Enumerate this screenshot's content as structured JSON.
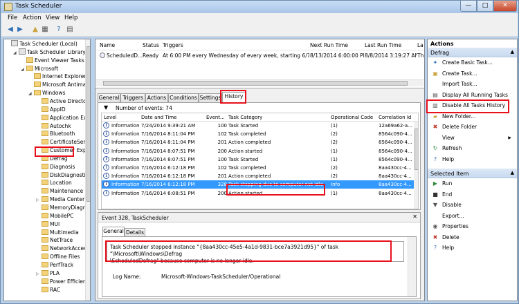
{
  "window": {
    "title": "Task Scheduler",
    "min": "—",
    "max": "□",
    "close": "✕"
  },
  "menu": [
    "File",
    "Action",
    "View",
    "Help"
  ],
  "toolbar": [
    {
      "icon": "back-arrow-icon",
      "glyph": "◀",
      "color": "#2e6fb5"
    },
    {
      "icon": "forward-arrow-icon",
      "glyph": "▶",
      "color": "#2e6fb5"
    },
    {
      "icon": "up-folder-icon",
      "glyph": "▲",
      "color": "#c9a23c"
    },
    {
      "icon": "show-hide-tree-icon",
      "glyph": "▦",
      "color": "#555555"
    },
    {
      "icon": "help-icon",
      "glyph": "?",
      "color": "#2e6fb5"
    },
    {
      "icon": "properties-icon",
      "glyph": "▤",
      "color": "#555555"
    }
  ],
  "tree": [
    {
      "label": "Task Scheduler (Local)",
      "depth": 0,
      "exp": "",
      "icon": "lib"
    },
    {
      "label": "Task Scheduler Library",
      "depth": 1,
      "exp": "◢",
      "icon": "lib"
    },
    {
      "label": "Event Viewer Tasks",
      "depth": 2,
      "exp": "",
      "icon": "folder"
    },
    {
      "label": "Microsoft",
      "depth": 2,
      "exp": "◢",
      "icon": "folder"
    },
    {
      "label": "Internet Explorer",
      "depth": 3,
      "exp": "",
      "icon": "folder"
    },
    {
      "label": "Microsoft Antimal",
      "depth": 3,
      "exp": "",
      "icon": "folder"
    },
    {
      "label": "Windows",
      "depth": 3,
      "exp": "◢",
      "icon": "folder"
    },
    {
      "label": "Active Director",
      "depth": 4,
      "exp": "",
      "icon": "folder"
    },
    {
      "label": "AppID",
      "depth": 4,
      "exp": "",
      "icon": "folder"
    },
    {
      "label": "Application Exp",
      "depth": 4,
      "exp": "",
      "icon": "folder"
    },
    {
      "label": "Autochk",
      "depth": 4,
      "exp": "",
      "icon": "folder"
    },
    {
      "label": "Bluetooth",
      "depth": 4,
      "exp": "",
      "icon": "folder"
    },
    {
      "label": "CertificateServi",
      "depth": 4,
      "exp": "",
      "icon": "folder"
    },
    {
      "label": "Customer Expe",
      "depth": 4,
      "exp": "",
      "icon": "folder"
    },
    {
      "label": "Defrag",
      "depth": 4,
      "exp": "",
      "icon": "folder"
    },
    {
      "label": "Diagnosis",
      "depth": 4,
      "exp": "",
      "icon": "folder"
    },
    {
      "label": "DiskDiagnostic",
      "depth": 4,
      "exp": "",
      "icon": "folder"
    },
    {
      "label": "Location",
      "depth": 4,
      "exp": "",
      "icon": "folder"
    },
    {
      "label": "Maintenance",
      "depth": 4,
      "exp": "",
      "icon": "folder"
    },
    {
      "label": "Media Center",
      "depth": 4,
      "exp": "▷",
      "icon": "folder"
    },
    {
      "label": "MemoryDiagno",
      "depth": 4,
      "exp": "",
      "icon": "folder"
    },
    {
      "label": "MobilePC",
      "depth": 4,
      "exp": "",
      "icon": "folder"
    },
    {
      "label": "MUI",
      "depth": 4,
      "exp": "",
      "icon": "folder"
    },
    {
      "label": "Multimedia",
      "depth": 4,
      "exp": "",
      "icon": "folder"
    },
    {
      "label": "NetTrace",
      "depth": 4,
      "exp": "",
      "icon": "folder"
    },
    {
      "label": "NetworkAccess",
      "depth": 4,
      "exp": "",
      "icon": "folder"
    },
    {
      "label": "Offline Files",
      "depth": 4,
      "exp": "",
      "icon": "folder"
    },
    {
      "label": "PerfTrack",
      "depth": 4,
      "exp": "",
      "icon": "folder"
    },
    {
      "label": "PLA",
      "depth": 4,
      "exp": "▷",
      "icon": "folder"
    },
    {
      "label": "Power Efficienc",
      "depth": 4,
      "exp": "",
      "icon": "folder"
    },
    {
      "label": "RAC",
      "depth": 4,
      "exp": "",
      "icon": "folder"
    }
  ],
  "tasklist": {
    "headers": [
      "Name",
      "Status",
      "Triggers",
      "Next Run Time",
      "Last Run Time",
      "La"
    ],
    "row": [
      "ScheduledD...",
      "Ready",
      "At 6:00 PM every Wednesday of every week, starting 6/7/2012",
      "8/13/2014 6:00:00 PM",
      "8/8/2014 3:19:27 AM",
      "Th"
    ]
  },
  "tabs": [
    "General",
    "Triggers",
    "Actions",
    "Conditions",
    "Settings",
    "History"
  ],
  "history": {
    "count_text": "Number of events: 74",
    "headers": [
      "Level",
      "Date and Time",
      "Event...",
      "Task Category",
      "Operational Code",
      "Correlation Id"
    ],
    "rows": [
      [
        "Information",
        "7/24/2014 9:39:21 AM",
        "100",
        "Task Started",
        "(1)",
        "12a69a62-a..."
      ],
      [
        "Information",
        "7/16/2014 8:11:04 PM",
        "102",
        "Task completed",
        "(2)",
        "8564c090-4..."
      ],
      [
        "Information",
        "7/16/2014 8:11:04 PM",
        "201",
        "Action completed",
        "(2)",
        "8564c090-4..."
      ],
      [
        "Information",
        "7/16/2014 8:07:51 PM",
        "200",
        "Action started",
        "(1)",
        "8564c090-4..."
      ],
      [
        "Information",
        "7/16/2014 8:07:51 PM",
        "100",
        "Task Started",
        "(1)",
        "8564c090-4..."
      ],
      [
        "Information",
        "7/16/2014 6:12:18 PM",
        "102",
        "Task completed",
        "(2)",
        "8aa430cc-4..."
      ],
      [
        "Information",
        "7/16/2014 6:12:18 PM",
        "201",
        "Action completed",
        "(2)",
        "8aa430cc-4..."
      ],
      [
        "Information",
        "7/16/2014 6:12:18 PM",
        "328",
        "Task stopping due to computer not idle",
        "Info",
        "8aa430cc-4..."
      ],
      [
        "Information",
        "7/16/2014 6:08:51 PM",
        "200",
        "Action started",
        "(1)",
        "8aa430cc-4..."
      ]
    ],
    "selected_index": 7
  },
  "event_detail": {
    "title": "Event 328, TaskScheduler",
    "close": "✕",
    "tabs": [
      "General",
      "Details"
    ],
    "message_line1": "Task Scheduler stopped instance \"{8aa430cc-45e5-4a1d-9831-bce7a3921d95}\"  of task \"\\Microsoft\\Windows\\Defrag",
    "message_line2": "\\ScheduledDefrag\"  because computer is no longer idle.",
    "log_name_label": "Log Name:",
    "log_name_value": "Microsoft-Windows-TaskScheduler/Operational"
  },
  "actions_pane": {
    "header": "Actions",
    "section1": "Defrag",
    "items1": [
      {
        "label": "Create Basic Task...",
        "icon": "create-basic-task-icon",
        "glyph": "✦",
        "color": "#2e6fb5"
      },
      {
        "label": "Create Task...",
        "icon": "create-task-icon",
        "glyph": "▣",
        "color": "#c9a23c"
      },
      {
        "label": "Import Task...",
        "icon": "import-task-icon",
        "glyph": "",
        "color": "#000000"
      },
      {
        "label": "Display All Running Tasks",
        "icon": "running-tasks-icon",
        "glyph": "▤",
        "color": "#555555"
      },
      {
        "label": "Disable All Tasks History",
        "icon": "tasks-history-icon",
        "glyph": "▥",
        "color": "#555555"
      },
      {
        "label": "New Folder...",
        "icon": "new-folder-icon",
        "glyph": "▰",
        "color": "#c9a23c"
      },
      {
        "label": "Delete Folder",
        "icon": "delete-icon",
        "glyph": "✖",
        "color": "#c0392b"
      },
      {
        "label": "View",
        "icon": "view-icon",
        "glyph": "",
        "color": "#000000",
        "submenu": "▶"
      },
      {
        "label": "Refresh",
        "icon": "refresh-icon",
        "glyph": "↻",
        "color": "#2e8b3a"
      },
      {
        "label": "Help",
        "icon": "help-icon",
        "glyph": "?",
        "color": "#2e6fb5"
      }
    ],
    "section2": "Selected Item",
    "items2": [
      {
        "label": "Run",
        "icon": "run-icon",
        "glyph": "▶",
        "color": "#2e8b3a"
      },
      {
        "label": "End",
        "icon": "end-icon",
        "glyph": "■",
        "color": "#333333"
      },
      {
        "label": "Disable",
        "icon": "disable-icon",
        "glyph": "▼",
        "color": "#555555"
      },
      {
        "label": "Export...",
        "icon": "export-icon",
        "glyph": "",
        "color": "#000000"
      },
      {
        "label": "Properties",
        "icon": "properties-icon",
        "glyph": "◉",
        "color": "#555555"
      },
      {
        "label": "Delete",
        "icon": "delete-icon",
        "glyph": "✖",
        "color": "#c0392b"
      },
      {
        "label": "Help",
        "icon": "help-icon",
        "glyph": "?",
        "color": "#2e6fb5"
      }
    ],
    "collapse_glyph": "▲"
  },
  "highlight_color": "#e8101a"
}
